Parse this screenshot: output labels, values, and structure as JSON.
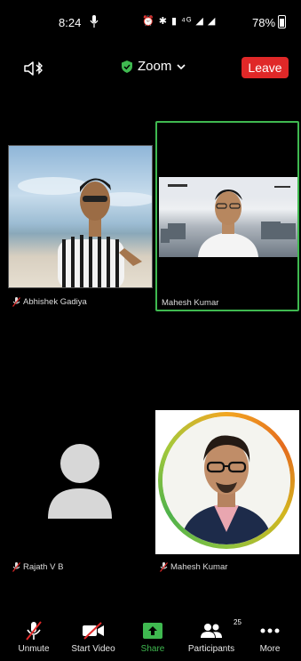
{
  "status_bar": {
    "time": "8:24",
    "icons_text": "⏰ ✱ ▮ ⁴ᴳ ◢ ◢",
    "battery": "78%"
  },
  "top_bar": {
    "title": "Zoom",
    "leave_label": "Leave",
    "leave_color": "#e02828",
    "secure_color": "#3fb950"
  },
  "participants_grid": [
    {
      "name": "Abhishek Gadiya",
      "muted": true,
      "active_speaker": false
    },
    {
      "name": "Mahesh Kumar",
      "muted": false,
      "active_speaker": true
    },
    {
      "name": "Rajath V B",
      "muted": true,
      "active_speaker": false
    },
    {
      "name": "Mahesh Kumar",
      "muted": true,
      "active_speaker": false
    }
  ],
  "toolbar": {
    "unmute": "Unmute",
    "start_video": "Start Video",
    "share": "Share",
    "participants": "Participants",
    "participants_count": "25",
    "more": "More"
  }
}
